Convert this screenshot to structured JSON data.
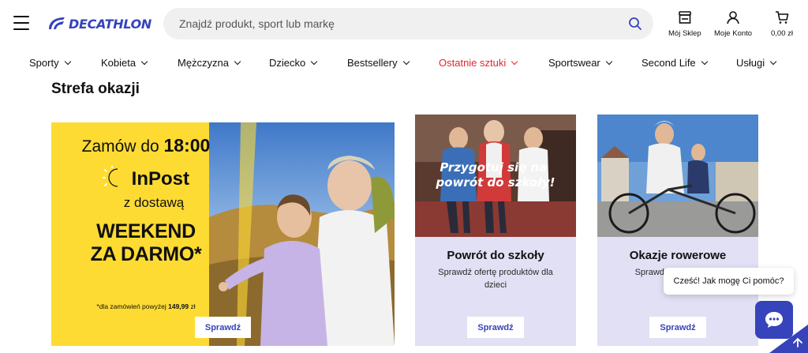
{
  "header": {
    "logo_text": "DECATHLON",
    "search_placeholder": "Znajdź produkt, sport lub markę",
    "store_label": "Mój Sklep",
    "account_label": "Moje Konto",
    "cart_label": "0,00 zł"
  },
  "nav": {
    "items": [
      {
        "label": "Sporty"
      },
      {
        "label": "Kobieta"
      },
      {
        "label": "Mężczyzna"
      },
      {
        "label": "Dziecko"
      },
      {
        "label": "Bestsellery"
      },
      {
        "label": "Ostatnie sztuki"
      },
      {
        "label": "Sportswear"
      },
      {
        "label": "Second Life"
      },
      {
        "label": "Usługi"
      }
    ]
  },
  "section": {
    "title": "Strefa okazji"
  },
  "promo": {
    "line1_prefix": "Zamów do ",
    "line1_time": "18:00",
    "brand": "InPost",
    "line3": "z dostawą",
    "line4": "WEEKEND",
    "line5": "ZA DARMO*",
    "footnote_prefix": "*dla zamówień powyżej ",
    "footnote_amount": "149,99",
    "footnote_suffix": " zł",
    "button": "Sprawdź"
  },
  "cards": [
    {
      "overlay": "Przygotuj się na powrót do szkoły!",
      "title": "Powrót do szkoły",
      "desc": "Sprawdź ofertę produktów dla dzieci",
      "button": "Sprawdź"
    },
    {
      "title": "Okazje rowerowe",
      "desc": "Sprawdź okaz... od I...",
      "button": "Sprawdź"
    }
  ],
  "chat": {
    "bubble": "Cześć! Jak mogę Ci pomóc?"
  },
  "colors": {
    "brand": "#3643ba",
    "promo_yellow": "#fedb33",
    "card_bg": "#e1e0f4",
    "sale_red": "#e3262f"
  }
}
